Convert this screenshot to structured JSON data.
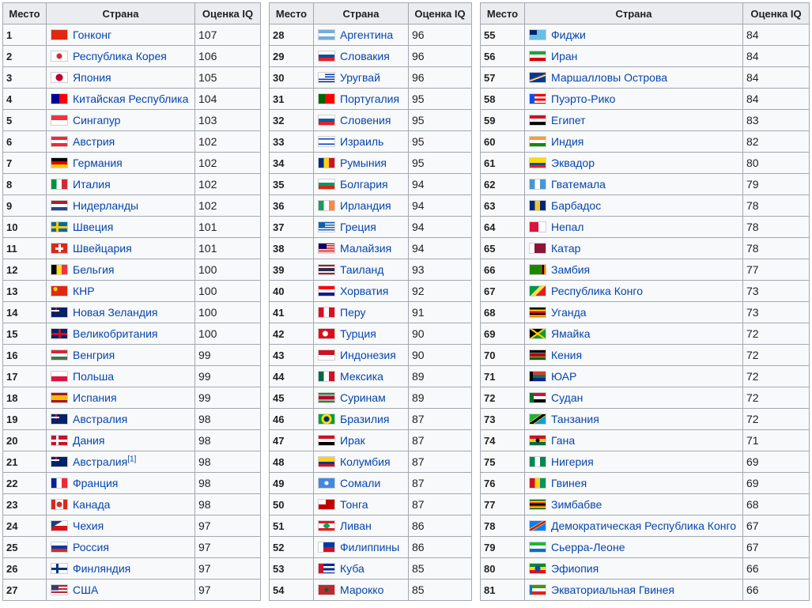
{
  "headers": {
    "rank": "Место",
    "country": "Страна",
    "iq": "Оценка IQ"
  },
  "tables": [
    {
      "rows": [
        {
          "rank": "1",
          "country": "Гонконг",
          "iq": "107",
          "flag": "linear-gradient(#de2910,#de2910)"
        },
        {
          "rank": "2",
          "country": "Республика Корея",
          "iq": "106",
          "flag": "radial-gradient(circle at 50% 50%,#cd2e3a 0 3px,#ffffff 4px)"
        },
        {
          "rank": "3",
          "country": "Япония",
          "iq": "105",
          "flag": "radial-gradient(circle at 50% 50%,#bc002d 0 4px,#ffffff 5px)"
        },
        {
          "rank": "4",
          "country": "Китайская Республика",
          "iq": "104",
          "flag": "linear-gradient(90deg,#000095 0 50%,#fe0000 50%)"
        },
        {
          "rank": "5",
          "country": "Сингапур",
          "iq": "103",
          "flag": "linear-gradient(#ef3340 50%,#ffffff 50%)"
        },
        {
          "rank": "6",
          "country": "Австрия",
          "iq": "102",
          "flag": "linear-gradient(#ed2939 33%,#ffffff 33% 66%,#ed2939 66%)"
        },
        {
          "rank": "7",
          "country": "Германия",
          "iq": "102",
          "flag": "linear-gradient(#000000 33%,#dd0000 33% 66%,#ffce00 66%)"
        },
        {
          "rank": "8",
          "country": "Италия",
          "iq": "102",
          "flag": "linear-gradient(90deg,#009246 33%,#ffffff 33% 66%,#ce2b37 66%)"
        },
        {
          "rank": "9",
          "country": "Нидерланды",
          "iq": "102",
          "flag": "linear-gradient(#ae1c28 33%,#ffffff 33% 66%,#21468b 66%)"
        },
        {
          "rank": "10",
          "country": "Швеция",
          "iq": "101",
          "flag": "linear-gradient(#fecc00,#fecc00) 0 50%/100% 3px no-repeat,linear-gradient(#fecc00,#fecc00) 35% 0/3px 100% no-repeat,#006aa7"
        },
        {
          "rank": "11",
          "country": "Швейцария",
          "iq": "101",
          "flag": "linear-gradient(#ffffff,#ffffff) 50% 50%/10px 3px no-repeat,linear-gradient(#ffffff,#ffffff) 50% 50%/3px 10px no-repeat,#d52b1e"
        },
        {
          "rank": "12",
          "country": "Бельгия",
          "iq": "100",
          "flag": "linear-gradient(90deg,#000000 33%,#fdda24 33% 66%,#ef3340 66%)"
        },
        {
          "rank": "13",
          "country": "КНР",
          "iq": "100",
          "flag": "radial-gradient(circle at 25% 30%,#ffde00 0 2px,transparent 3px),#de2910"
        },
        {
          "rank": "14",
          "country": "Новая Зеландия",
          "iq": "100",
          "flag": "linear-gradient(#ffffff,#ffffff) 0 25%/50% 2px no-repeat,linear-gradient(#c8102e,#c8102e) 25% 0/2px 50% no-repeat,#012169"
        },
        {
          "rank": "15",
          "country": "Великобритания",
          "iq": "100",
          "flag": "linear-gradient(#c8102e,#c8102e) 0 50%/100% 3px no-repeat,linear-gradient(#c8102e,#c8102e) 50% 0/3px 100% no-repeat,#012169"
        },
        {
          "rank": "16",
          "country": "Венгрия",
          "iq": "99",
          "flag": "linear-gradient(#ce2939 33%,#ffffff 33% 66%,#477050 66%)"
        },
        {
          "rank": "17",
          "country": "Польша",
          "iq": "99",
          "flag": "linear-gradient(#ffffff 50%,#dc143c 50%)"
        },
        {
          "rank": "18",
          "country": "Испания",
          "iq": "99",
          "flag": "linear-gradient(#aa151b 25%,#f1bf00 25% 75%,#aa151b 75%)"
        },
        {
          "rank": "19",
          "country": "Австралия",
          "iq": "98",
          "flag": "linear-gradient(#ffffff,#ffffff) 0 25%/50% 2px no-repeat,linear-gradient(#c8102e,#c8102e) 25% 0/2px 50% no-repeat,#012169"
        },
        {
          "rank": "20",
          "country": "Дания",
          "iq": "98",
          "flag": "linear-gradient(#ffffff,#ffffff) 0 50%/100% 3px no-repeat,linear-gradient(#ffffff,#ffffff) 35% 0/3px 100% no-repeat,#c8102e"
        },
        {
          "rank": "21",
          "country": "Австралия",
          "iq": "98",
          "ref": "[1]",
          "flag": "linear-gradient(#ffffff,#ffffff) 0 25%/50% 2px no-repeat,linear-gradient(#c8102e,#c8102e) 25% 0/2px 50% no-repeat,#012169"
        },
        {
          "rank": "22",
          "country": "Франция",
          "iq": "98",
          "flag": "linear-gradient(90deg,#002395 33%,#ffffff 33% 66%,#ed2939 66%)"
        },
        {
          "rank": "23",
          "country": "Канада",
          "iq": "98",
          "flag": "radial-gradient(circle at 50% 50%,#d52b1e 0 3px,transparent 4px),linear-gradient(90deg,#d52b1e 25%,#ffffff 25% 75%,#d52b1e 75%)"
        },
        {
          "rank": "24",
          "country": "Чехия",
          "iq": "97",
          "flag": "linear-gradient(to bottom right,#11457e 0 35%,transparent 35%),linear-gradient(#ffffff 50%,#d7141a 50%)"
        },
        {
          "rank": "25",
          "country": "Россия",
          "iq": "97",
          "flag": "linear-gradient(#ffffff 33%,#0039a6 33% 66%,#d52b1e 66%)"
        },
        {
          "rank": "26",
          "country": "Финляндия",
          "iq": "97",
          "flag": "linear-gradient(#003580,#003580) 0 50%/100% 3px no-repeat,linear-gradient(#003580,#003580) 35% 0/3px 100% no-repeat,#ffffff"
        },
        {
          "rank": "27",
          "country": "США",
          "iq": "97",
          "flag": "linear-gradient(#3c3b6e,#3c3b6e) 0 0/45% 55% no-repeat,repeating-linear-gradient(#b22234 0 2px,#ffffff 2px 4px)"
        }
      ]
    },
    {
      "rows": [
        {
          "rank": "28",
          "country": "Аргентина",
          "iq": "96",
          "flag": "linear-gradient(#74acdf 33%,#ffffff 33% 66%,#74acdf 66%)"
        },
        {
          "rank": "29",
          "country": "Словакия",
          "iq": "96",
          "flag": "linear-gradient(#ffffff 33%,#0b4ea2 33% 66%,#ee1c25 66%)"
        },
        {
          "rank": "30",
          "country": "Уругвай",
          "iq": "96",
          "flag": "linear-gradient(#ffffff,#ffffff) 0 0/40% 50% no-repeat,repeating-linear-gradient(#ffffff 0 1.5px,#0038a8 1.5px 3px)"
        },
        {
          "rank": "31",
          "country": "Португалия",
          "iq": "95",
          "flag": "linear-gradient(90deg,#006600 40%,#ff0000 40%)"
        },
        {
          "rank": "32",
          "country": "Словения",
          "iq": "95",
          "flag": "linear-gradient(#ffffff 33%,#005da4 33% 66%,#ed1c24 66%)"
        },
        {
          "rank": "33",
          "country": "Израиль",
          "iq": "95",
          "flag": "linear-gradient(#ffffff 15%,#0038b8 15% 28%,#ffffff 28% 72%,#0038b8 72% 85%,#ffffff 85%)"
        },
        {
          "rank": "34",
          "country": "Румыния",
          "iq": "95",
          "flag": "linear-gradient(90deg,#002b7f 33%,#fcd116 33% 66%,#ce1126 66%)"
        },
        {
          "rank": "35",
          "country": "Болгария",
          "iq": "94",
          "flag": "linear-gradient(#ffffff 33%,#00966e 33% 66%,#d62612 66%)"
        },
        {
          "rank": "36",
          "country": "Ирландия",
          "iq": "94",
          "flag": "linear-gradient(90deg,#169b62 33%,#ffffff 33% 66%,#ff883e 66%)"
        },
        {
          "rank": "37",
          "country": "Греция",
          "iq": "94",
          "flag": "linear-gradient(#0d5eaf,#0d5eaf) 0 0/40% 55% no-repeat,repeating-linear-gradient(#0d5eaf 0 1.5px,#ffffff 1.5px 3px)"
        },
        {
          "rank": "38",
          "country": "Малайзия",
          "iq": "94",
          "flag": "linear-gradient(#010066,#010066) 0 0/50% 55% no-repeat,repeating-linear-gradient(#cc0001 0 1px,#ffffff 1px 2px)"
        },
        {
          "rank": "39",
          "country": "Таиланд",
          "iq": "93",
          "flag": "linear-gradient(#a51931 16%,#f4f5f8 16% 33%,#2d2a4a 33% 66%,#f4f5f8 66% 83%,#a51931 83%)"
        },
        {
          "rank": "40",
          "country": "Хорватия",
          "iq": "92",
          "flag": "linear-gradient(#ff0000 33%,#ffffff 33% 66%,#171796 66%)"
        },
        {
          "rank": "41",
          "country": "Перу",
          "iq": "91",
          "flag": "linear-gradient(90deg,#d91023 33%,#ffffff 33% 66%,#d91023 66%)"
        },
        {
          "rank": "42",
          "country": "Турция",
          "iq": "90",
          "flag": "radial-gradient(circle at 42% 50%,#ffffff 0 3px,transparent 4px),#e30a17"
        },
        {
          "rank": "43",
          "country": "Индонезия",
          "iq": "90",
          "flag": "linear-gradient(#ce1126 50%,#ffffff 50%)"
        },
        {
          "rank": "44",
          "country": "Мексика",
          "iq": "89",
          "flag": "linear-gradient(90deg,#006847 33%,#ffffff 33% 66%,#ce1126 66%)"
        },
        {
          "rank": "45",
          "country": "Суринам",
          "iq": "89",
          "flag": "linear-gradient(#377e3f 20%,#ffffff 20% 28%,#b40a2d 28% 72%,#ffffff 72% 80%,#377e3f 80%)"
        },
        {
          "rank": "46",
          "country": "Бразилия",
          "iq": "87",
          "flag": "radial-gradient(circle,#002776 0 3px,#ffdf00 4px 6px,#009c3b 7px)"
        },
        {
          "rank": "47",
          "country": "Ирак",
          "iq": "87",
          "flag": "linear-gradient(#ce1126 33%,#ffffff 33% 66%,#000000 66%)"
        },
        {
          "rank": "48",
          "country": "Колумбия",
          "iq": "87",
          "flag": "linear-gradient(#fcd116 50%,#003893 50% 75%,#ce1126 75%)"
        },
        {
          "rank": "49",
          "country": "Сомали",
          "iq": "87",
          "flag": "radial-gradient(circle,#ffffff 0 2px,transparent 3px),#4189dd"
        },
        {
          "rank": "50",
          "country": "Тонга",
          "iq": "87",
          "flag": "linear-gradient(#ffffff,#ffffff) 0 0/45% 50% no-repeat,#c10000"
        },
        {
          "rank": "51",
          "country": "Ливан",
          "iq": "86",
          "flag": "radial-gradient(ellipse 4px 3px at 50% 50%,#00a651 0 100%,transparent 100%),linear-gradient(#ee161f 25%,#ffffff 25% 75%,#ee161f 75%)"
        },
        {
          "rank": "52",
          "country": "Филиппины",
          "iq": "86",
          "flag": "linear-gradient(to right,#ffffff 0 30%,transparent 30%),linear-gradient(#0038a8 50%,#ce1126 50%)"
        },
        {
          "rank": "53",
          "country": "Куба",
          "iq": "85",
          "flag": "linear-gradient(to right,#cf142b 0 30%,transparent 30%),repeating-linear-gradient(#002a8f 0 2.8px,#ffffff 2.8px 5.6px)"
        },
        {
          "rank": "54",
          "country": "Марокко",
          "iq": "85",
          "flag": "radial-gradient(circle,#006233 0 2px,transparent 3px),#c1272d"
        }
      ]
    },
    {
      "rows": [
        {
          "rank": "55",
          "country": "Фиджи",
          "iq": "84",
          "flag": "linear-gradient(#012169,#012169) 0 0/45% 50% no-repeat,#68bfe5"
        },
        {
          "rank": "56",
          "country": "Иран",
          "iq": "84",
          "flag": "linear-gradient(#239f40 33%,#ffffff 33% 66%,#da0000 66%)"
        },
        {
          "rank": "57",
          "country": "Маршалловы Острова",
          "iq": "84",
          "flag": "linear-gradient(160deg,transparent 45%,#dd7500 45% 52%,#ffffff 52% 58%,transparent 58%),#003893"
        },
        {
          "rank": "58",
          "country": "Пуэрто-Рико",
          "iq": "84",
          "flag": "linear-gradient(to right,#0050f0 0 30%,transparent 30%),repeating-linear-gradient(#ed0000 0 2.8px,#ffffff 2.8px 5.6px)"
        },
        {
          "rank": "59",
          "country": "Египет",
          "iq": "83",
          "flag": "linear-gradient(#ce1126 33%,#ffffff 33% 66%,#000000 66%)"
        },
        {
          "rank": "60",
          "country": "Индия",
          "iq": "82",
          "flag": "linear-gradient(#ff9933 33%,#ffffff 33% 66%,#138808 66%)"
        },
        {
          "rank": "61",
          "country": "Эквадор",
          "iq": "80",
          "flag": "linear-gradient(#ffdd00 50%,#034ea2 50% 75%,#ed1c24 75%)"
        },
        {
          "rank": "62",
          "country": "Гватемала",
          "iq": "79",
          "flag": "linear-gradient(90deg,#4997d0 33%,#ffffff 33% 66%,#4997d0 66%)"
        },
        {
          "rank": "63",
          "country": "Барбадос",
          "iq": "78",
          "flag": "linear-gradient(90deg,#00267f 33%,#ffc726 33% 66%,#00267f 66%)"
        },
        {
          "rank": "64",
          "country": "Непал",
          "iq": "78",
          "flag": "linear-gradient(to right,#dc143c 0 55%,#ffffff 55%)"
        },
        {
          "rank": "65",
          "country": "Катар",
          "iq": "78",
          "flag": "linear-gradient(90deg,#ffffff 30%,#8a1538 30%)"
        },
        {
          "rank": "66",
          "country": "Замбия",
          "iq": "77",
          "flag": "linear-gradient(90deg,transparent 70%,#de2010 70% 80%,#000000 80% 90%,#ef7d00 90%),#198a00"
        },
        {
          "rank": "67",
          "country": "Республика Конго",
          "iq": "73",
          "flag": "linear-gradient(135deg,#009543 40%,#fbde4a 40% 60%,#dc241f 60%)"
        },
        {
          "rank": "68",
          "country": "Уганда",
          "iq": "73",
          "flag": "repeating-linear-gradient(#000000 0 2.3px,#fcdc04 2.3px 4.6px,#d90000 4.6px 7px)"
        },
        {
          "rank": "69",
          "country": "Ямайка",
          "iq": "72",
          "flag": "linear-gradient(35deg,transparent 45%,#fed100 45% 55%,transparent 55%),linear-gradient(-35deg,#009b3a 45%,#fed100 45% 55%,#000000 55%)"
        },
        {
          "rank": "70",
          "country": "Кения",
          "iq": "72",
          "flag": "linear-gradient(#000000 30%,#ffffff 30% 35%,#bb0000 35% 65%,#ffffff 65% 70%,#006600 70%)"
        },
        {
          "rank": "71",
          "country": "ЮАР",
          "iq": "72",
          "flag": "linear-gradient(to right,#000000 0 20%,transparent 20%),linear-gradient(#de3831 33%,#007a4d 33% 66%,#002395 66%)"
        },
        {
          "rank": "72",
          "country": "Судан",
          "iq": "72",
          "flag": "linear-gradient(to right,#007229 0 25%,transparent 25%),linear-gradient(#d21034 33%,#ffffff 33% 66%,#000000 66%)"
        },
        {
          "rank": "73",
          "country": "Танзания",
          "iq": "72",
          "flag": "linear-gradient(145deg,#1eb53a 38%,#fcd116 38% 42%,#000000 42% 58%,#fcd116 58% 62%,#00a3dd 62%)"
        },
        {
          "rank": "74",
          "country": "Гана",
          "iq": "71",
          "flag": "radial-gradient(circle,#000000 0 2px,transparent 3px),linear-gradient(#ce1126 33%,#fcd116 33% 66%,#006b3f 66%)"
        },
        {
          "rank": "75",
          "country": "Нигерия",
          "iq": "69",
          "flag": "linear-gradient(90deg,#008751 33%,#ffffff 33% 66%,#008751 66%)"
        },
        {
          "rank": "76",
          "country": "Гвинея",
          "iq": "69",
          "flag": "linear-gradient(90deg,#ce1126 33%,#fcd116 33% 66%,#009460 66%)"
        },
        {
          "rank": "77",
          "country": "Зимбабве",
          "iq": "68",
          "flag": "linear-gradient(#006400 14%,#ffd200 14% 28%,#d40000 28% 42%,#000000 42% 58%,#d40000 58% 72%,#ffd200 72% 86%,#006400 86%)"
        },
        {
          "rank": "78",
          "country": "Демократическая Республика Конго",
          "iq": "67",
          "flag": "linear-gradient(150deg,#007fff 40%,#f7d618 40% 44%,#ce1021 44% 56%,#f7d618 56% 60%,#007fff 60%)"
        },
        {
          "rank": "79",
          "country": "Сьерра-Леоне",
          "iq": "67",
          "flag": "linear-gradient(#1eb53a 33%,#ffffff 33% 66%,#0072c6 66%)"
        },
        {
          "rank": "80",
          "country": "Эфиопия",
          "iq": "66",
          "flag": "radial-gradient(circle,#0f47af 0 3px,transparent 4px),linear-gradient(#078930 33%,#fcdd09 33% 66%,#da121a 66%)"
        },
        {
          "rank": "81",
          "country": "Экваториальная Гвинея",
          "iq": "66",
          "flag": "linear-gradient(to right,#0073ce 0 15%,transparent 15%),linear-gradient(#3e9a00 33%,#ffffff 33% 66%,#e32118 66%)"
        }
      ]
    }
  ]
}
